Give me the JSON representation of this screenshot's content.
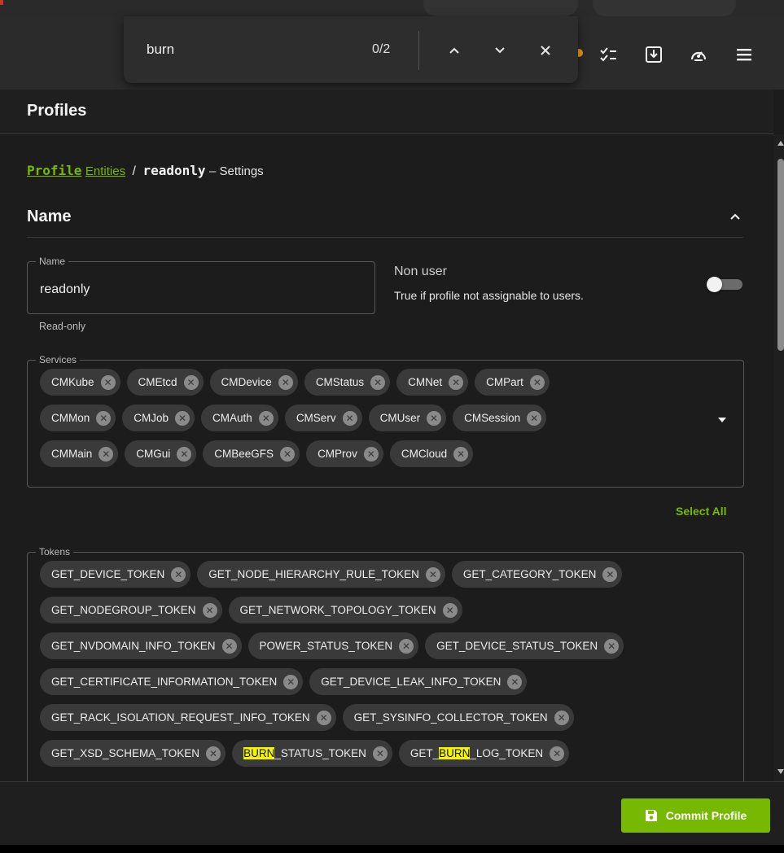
{
  "find": {
    "query": "burn",
    "count": "0/2"
  },
  "page": {
    "title": "Profiles"
  },
  "breadcrumb": {
    "profile": "Profile",
    "entities": "Entities",
    "separator": "/",
    "name": "readonly",
    "suffix": "– Settings"
  },
  "section": {
    "title": "Name"
  },
  "name_field": {
    "label": "Name",
    "value": "readonly",
    "helper": "Read-only"
  },
  "non_user": {
    "label": "Non user",
    "description": "True if profile not assignable to users.",
    "enabled": false
  },
  "services": {
    "label": "Services",
    "rows": [
      [
        "CMKube",
        "CMEtcd",
        "CMDevice",
        "CMStatus",
        "CMNet",
        "CMPart"
      ],
      [
        "CMMon",
        "CMJob",
        "CMAuth",
        "CMServ",
        "CMUser",
        "CMSession"
      ],
      [
        "CMMain",
        "CMGui",
        "CMBeeGFS",
        "CMProv",
        "CMCloud"
      ]
    ],
    "select_all": "Select All"
  },
  "tokens": {
    "label": "Tokens",
    "rows": [
      [
        "GET_DEVICE_TOKEN",
        "GET_NODE_HIERARCHY_RULE_TOKEN",
        "GET_CATEGORY_TOKEN"
      ],
      [
        "GET_NODEGROUP_TOKEN",
        "GET_NETWORK_TOPOLOGY_TOKEN"
      ],
      [
        "GET_NVDOMAIN_INFO_TOKEN",
        "POWER_STATUS_TOKEN",
        "GET_DEVICE_STATUS_TOKEN"
      ],
      [
        "GET_CERTIFICATE_INFORMATION_TOKEN",
        "GET_DEVICE_LEAK_INFO_TOKEN"
      ],
      [
        "GET_RACK_ISOLATION_REQUEST_INFO_TOKEN",
        "GET_SYSINFO_COLLECTOR_TOKEN"
      ],
      [
        "GET_XSD_SCHEMA_TOKEN",
        "BURN_STATUS_TOKEN",
        "GET_BURN_LOG_TOKEN"
      ]
    ],
    "highlight": "BURN"
  },
  "footer": {
    "commit_label": "Commit Profile"
  },
  "colors": {
    "accent": "#76b900",
    "highlight": "#f5f500"
  }
}
